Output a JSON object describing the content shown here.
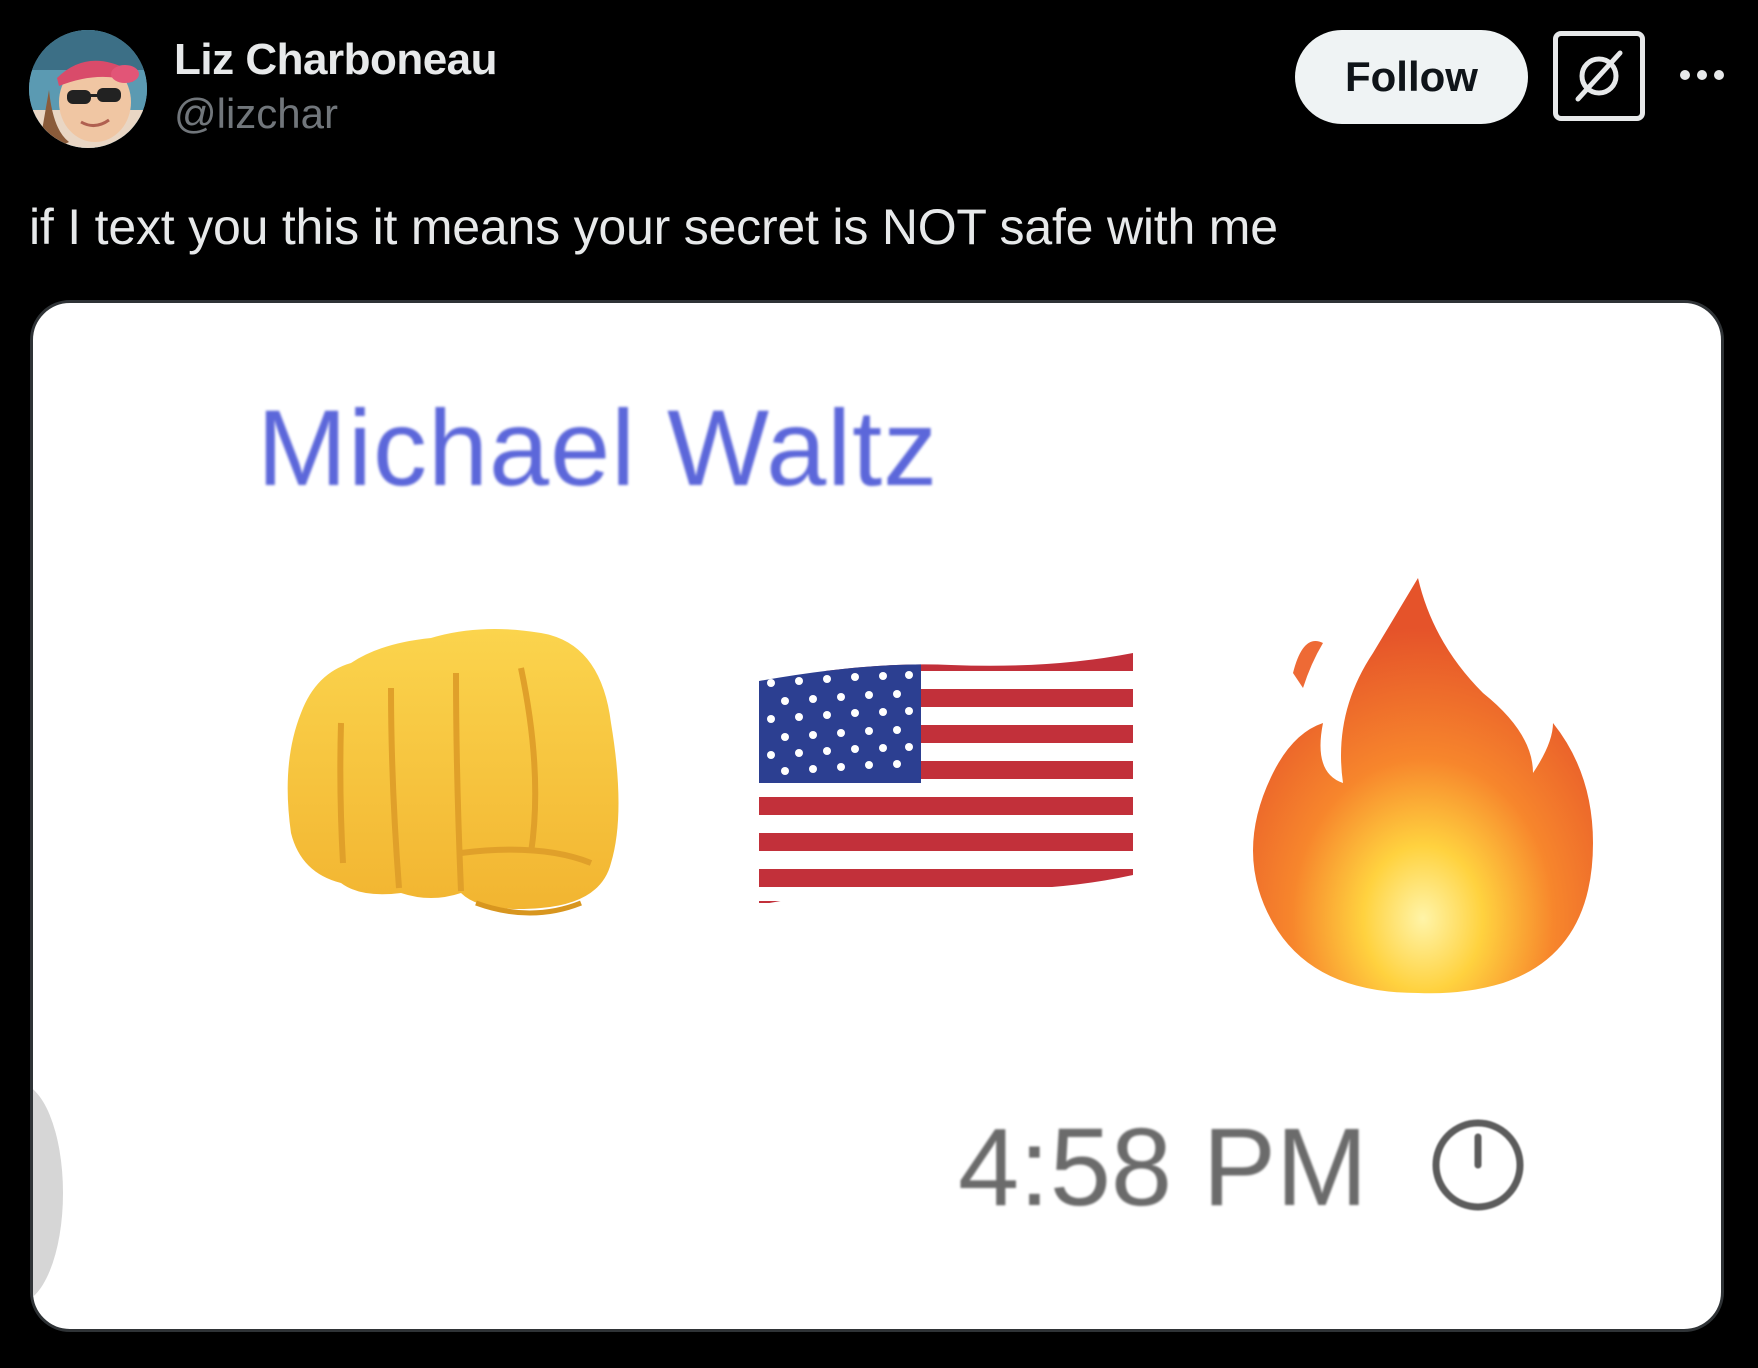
{
  "author": {
    "display_name": "Liz Charboneau",
    "handle": "@lizchar"
  },
  "actions": {
    "follow_label": "Follow",
    "grok_icon": "grok-icon",
    "more_icon": "more-horizontal-icon"
  },
  "tweet": {
    "text": "if I text you this it means your secret is NOT safe with me"
  },
  "media": {
    "sender_name": "Michael Waltz",
    "emojis": [
      "oncoming-fist-icon",
      "us-flag-icon",
      "fire-icon"
    ],
    "timestamp": "4:58 PM",
    "status_icon": "clock-icon"
  },
  "colors": {
    "background": "#000000",
    "follow_bg": "#eff3f4",
    "text": "#e7e9ea",
    "handle": "#71767b",
    "sender_name": "#4b57d6"
  }
}
